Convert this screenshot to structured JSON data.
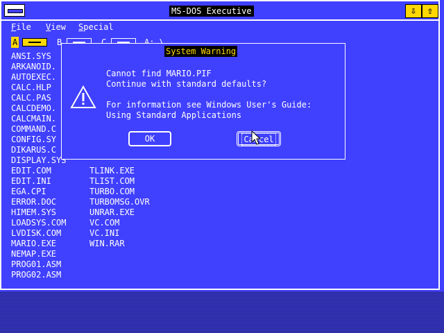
{
  "window": {
    "title": "MS-DOS Executive"
  },
  "menu": [
    {
      "label": "File",
      "u": "F",
      "rest": "ile"
    },
    {
      "label": "View",
      "u": "V",
      "rest": "iew"
    },
    {
      "label": "Special",
      "u": "S",
      "rest": "pecial"
    }
  ],
  "drives": [
    {
      "letter": "A",
      "selected": true
    },
    {
      "letter": "B",
      "selected": false
    },
    {
      "letter": "C",
      "selected": false
    }
  ],
  "current_path": "A: \\",
  "files_col1": [
    "ANSI.SYS",
    "ARKANOID.",
    "AUTOEXEC.",
    "CALC.HLP",
    "CALC.PAS",
    "CALCDEMO.",
    "CALCMAIN.",
    "COMMAND.C",
    "CONFIG.SY",
    "DIKARUS.C",
    "DISPLAY.SYS",
    "EDIT.COM",
    "EDIT.INI",
    "EGA.CPI",
    "ERROR.DOC",
    "HIMEM.SYS",
    "LOADSYS.COM",
    "LVDISK.COM",
    "MARIO.EXE",
    "NEMAP.EXE",
    "PROG01.ASM",
    "PROG02.ASM"
  ],
  "files_col2": [
    "TLINK.EXE",
    "TLIST.COM",
    "TURBO.COM",
    "TURBOMSG.OVR",
    "UNRAR.EXE",
    "VC.COM",
    "VC.INI",
    "WIN.RAR"
  ],
  "dialog": {
    "title": "System Warning",
    "line1": "Cannot find MARIO.PIF",
    "line2": "Continue with standard defaults?",
    "line3": "For information see Windows User's Guide:",
    "line4": "Using Standard Applications",
    "ok_label": "OK",
    "cancel_label": "Cancel",
    "icon": "warning-icon"
  },
  "colors": {
    "background": "#4040ff",
    "highlight": "#ffd800",
    "text": "#ffffff"
  }
}
